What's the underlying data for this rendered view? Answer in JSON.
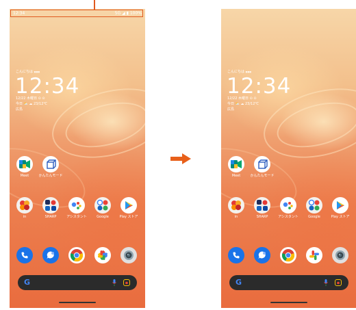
{
  "colors": {
    "highlight": "#e05a1f",
    "arrow": "#e8601a"
  },
  "left_screen": {
    "status": {
      "time": "12:34",
      "right": "5G ◢ ▮ 100%"
    },
    "lock": {
      "greeting": "こんにちは",
      "greeting_badge": "■■■",
      "clock": "12:34",
      "date": "12/22 木曜日 ⊙ ⊙",
      "weather": "今日 ⛅ ☁ 23/12℃",
      "location": "広島"
    },
    "apps_row1": [
      {
        "label": "Meet",
        "icon": "meet-icon"
      },
      {
        "label": "かんたんモード",
        "icon": "easy-mode-icon"
      }
    ],
    "apps_row2": [
      {
        "label": "in",
        "icon": "folder-icon"
      },
      {
        "label": "SHARP",
        "icon": "sharp-folder-icon"
      },
      {
        "label": "アシスタント",
        "icon": "assistant-icon"
      },
      {
        "label": "Google",
        "icon": "google-folder-icon"
      },
      {
        "label": "Play ストア",
        "icon": "play-store-icon"
      }
    ],
    "dock": [
      "phone-icon",
      "messages-icon",
      "chrome-icon",
      "photos-icon",
      "camera-icon"
    ],
    "search": {
      "logo": "G"
    }
  },
  "right_screen": {
    "lock": {
      "greeting": "こんにちは",
      "greeting_badge": "■■■",
      "clock": "12:34",
      "date": "12/22 木曜日 ⊙ ⊙",
      "weather": "今日 ⛅ ☁ 23/12℃",
      "location": "広島"
    },
    "apps_row1": [
      {
        "label": "Meet",
        "icon": "meet-icon"
      },
      {
        "label": "かんたんモード",
        "icon": "easy-mode-icon"
      }
    ],
    "apps_row2": [
      {
        "label": "in",
        "icon": "folder-icon"
      },
      {
        "label": "SHARP",
        "icon": "sharp-folder-icon"
      },
      {
        "label": "アシスタント",
        "icon": "assistant-icon"
      },
      {
        "label": "Google",
        "icon": "google-folder-icon"
      },
      {
        "label": "Play ストア",
        "icon": "play-store-icon"
      }
    ],
    "dock": [
      "phone-icon",
      "messages-icon",
      "chrome-icon",
      "photos-icon",
      "camera-icon"
    ],
    "search": {
      "logo": "G"
    }
  }
}
